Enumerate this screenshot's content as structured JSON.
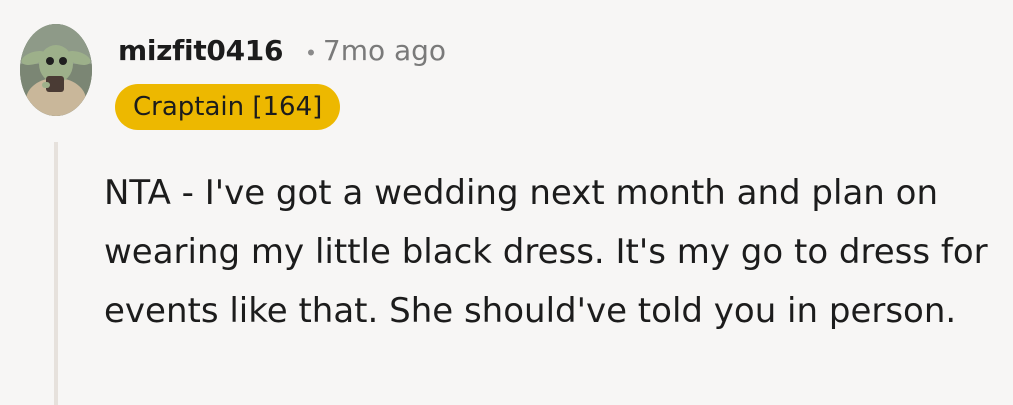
{
  "comment": {
    "username": "mizfit0416",
    "separator": "•",
    "timestamp": "7mo ago",
    "flair": "Craptain [164]",
    "body": "NTA - I've got a wedding next month and plan on wearing my little black dress. It's my go to dress for events like that. She should've told you in person."
  },
  "colors": {
    "background": "#f7f6f5",
    "flair_background": "#edb800",
    "thread_line": "#e6e1dc",
    "text": "#1c1c1c",
    "muted_text": "#7a7a7a"
  },
  "icons": {
    "avatar": "user-avatar-image"
  }
}
